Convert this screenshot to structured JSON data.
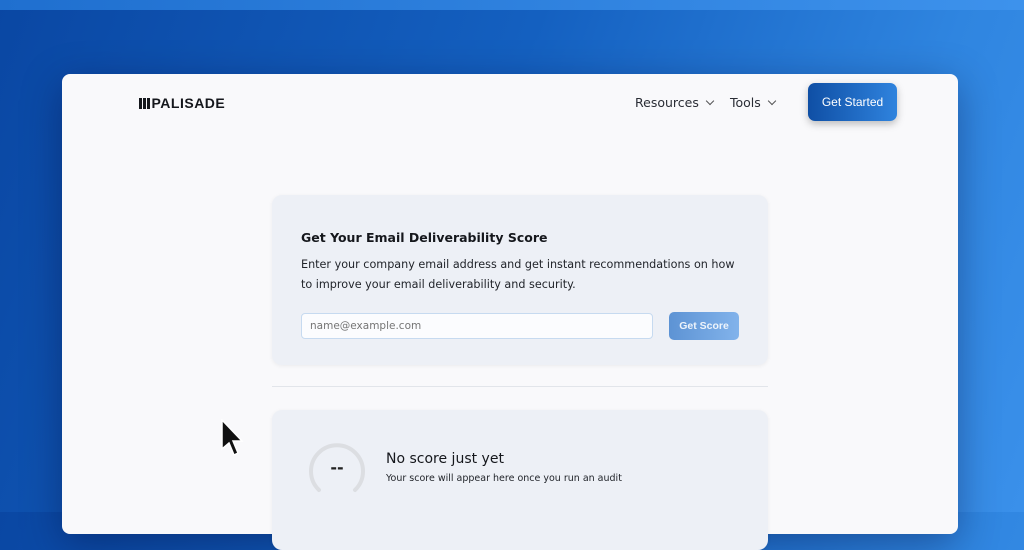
{
  "brand": {
    "logo": "PALISADE"
  },
  "nav": {
    "resources": "Resources",
    "tools": "Tools",
    "get_started": "Get Started"
  },
  "score_form": {
    "title": "Get Your Email Deliverability Score",
    "description": "Enter your company email address and get instant recommendations on how to improve your email deliverability and security.",
    "email_placeholder": "name@example.com",
    "email_value": "",
    "submit_label": "Get Score"
  },
  "score_result": {
    "score": "--",
    "title": "No score just yet",
    "subtitle": "Your score will appear here once you run an audit"
  }
}
